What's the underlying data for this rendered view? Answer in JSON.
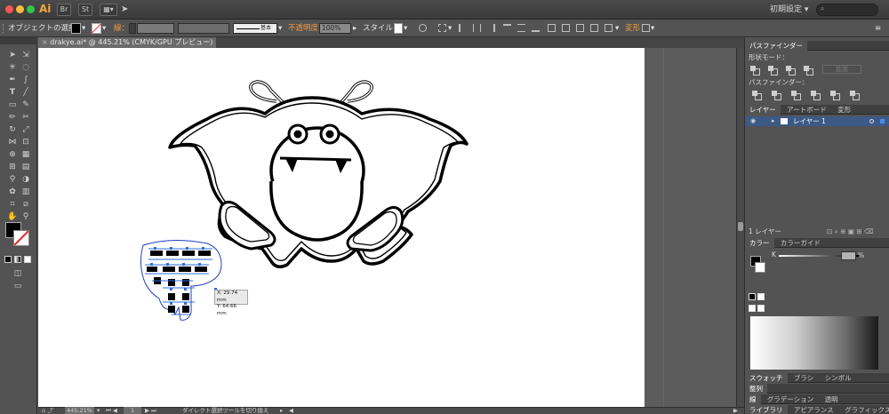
{
  "app": {
    "logo": "Ai",
    "bridge_label": "Br",
    "stock_label": "St",
    "workspace": "初期設定",
    "workspace_arrow": "▾"
  },
  "control_bar": {
    "selection_label": "オブジェクトの選択",
    "stroke_label": "線：",
    "brush_label": "基本",
    "opacity_label": "不透明度：",
    "opacity_value": "100%",
    "style_label": "スタイル：",
    "transform_label": "変形"
  },
  "document": {
    "tab_title": "drakye.ai* @ 445.21% (CMYK/GPU プレビュー)",
    "tooltip_x": "X: 29.74 mm",
    "tooltip_y": "Y: 64.66 mm"
  },
  "status_bar": {
    "zoom": "445.21%",
    "page": "1",
    "status_text": "ダイレクト選択ツールを切り換え"
  },
  "pathfinder": {
    "tab": "パスファインダー",
    "shape_modes_label": "形状モード：",
    "pathfinders_label": "パスファインダー：",
    "expand_button": "拡張"
  },
  "layers": {
    "tabs": [
      "レイヤー",
      "アートボード",
      "変形"
    ],
    "layer_name": "レイヤー 1",
    "count_label": "1 レイヤー"
  },
  "color": {
    "tabs": [
      "カラー",
      "カラーガイド"
    ],
    "channel_label": "K",
    "channel_value": "",
    "unit": "%"
  },
  "swatches": {
    "tabs": [
      "スウォッチ",
      "ブラシ",
      "シンボル"
    ],
    "collapsed_label": "整列"
  },
  "gradient": {
    "tabs": [
      "線",
      "グラデーション",
      "透明"
    ]
  },
  "library": {
    "tabs": [
      "ライブラリ",
      "アピアランス",
      "グラフィックスタイ"
    ]
  },
  "colors": {
    "ui_bg": "#535353",
    "accent_orange": "#f09a3e",
    "selection_blue": "#3a5bd1",
    "layer_row_blue": "#3d5a86"
  }
}
